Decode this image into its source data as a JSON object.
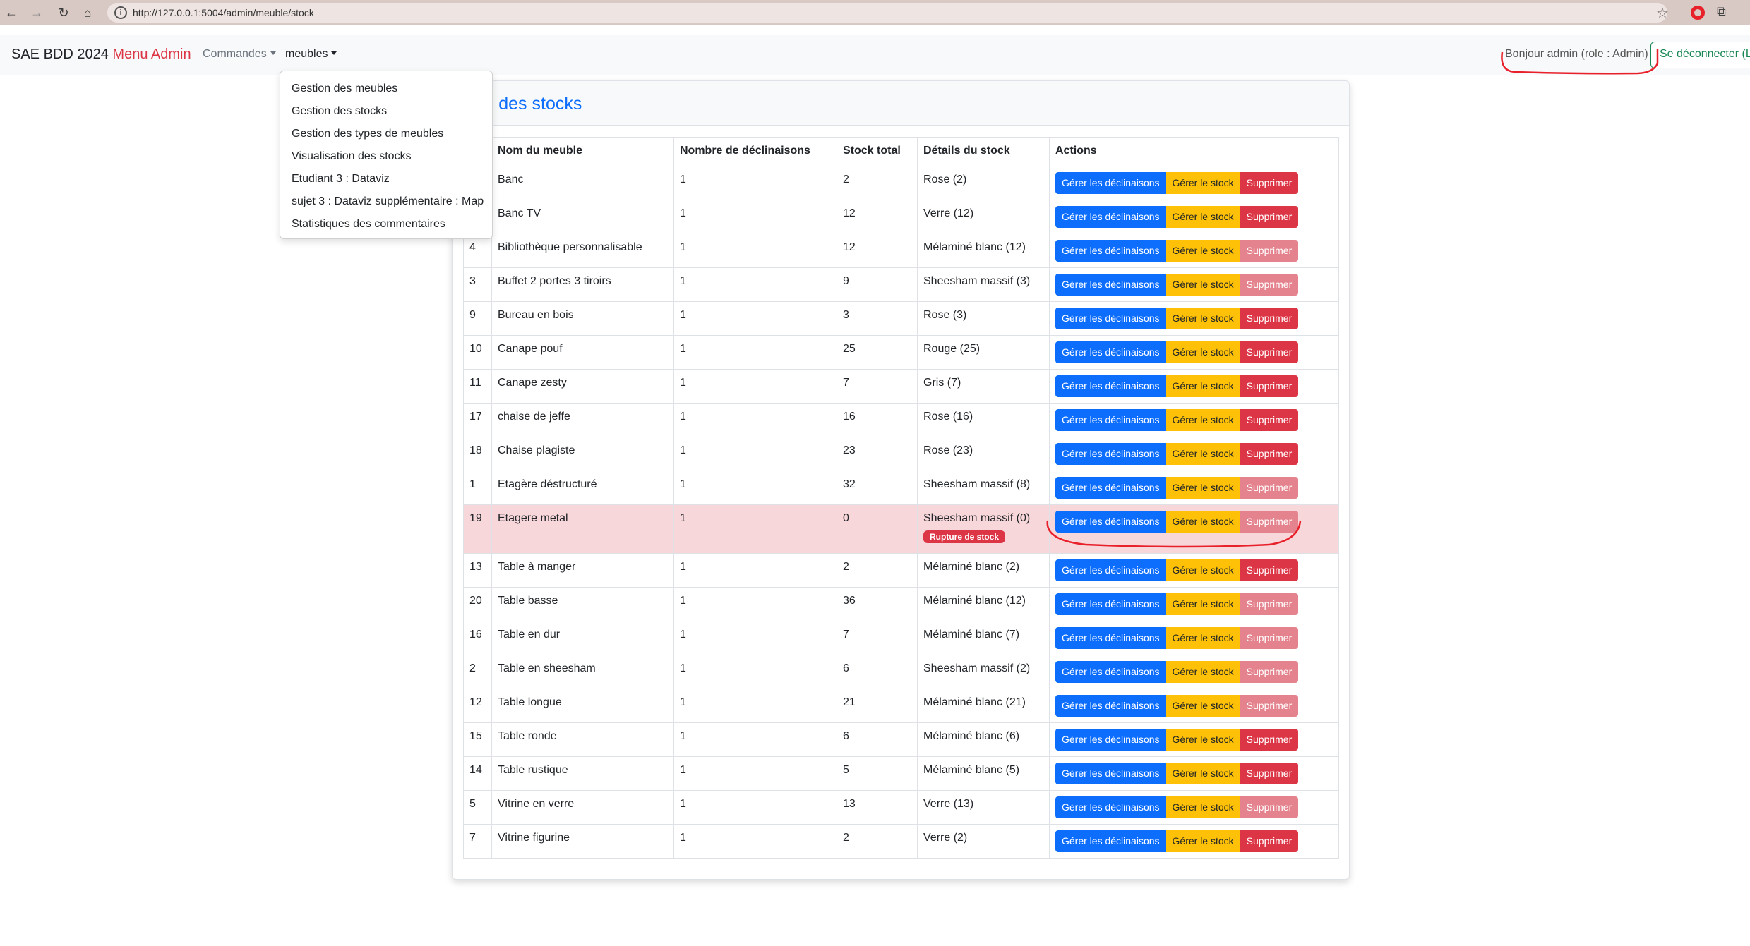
{
  "browser": {
    "url": "http://127.0.0.1:5004/admin/meuble/stock"
  },
  "navbar": {
    "brand": "SAE BDD 2024",
    "brand_accent": "Menu Admin",
    "menu_commandes": "Commandes",
    "menu_meubles": "meubles",
    "greeting": "Bonjour admin (role : Admin)",
    "logout_label": "Se déconnecter (Lo"
  },
  "dropdown": {
    "items": [
      "Gestion des meubles",
      "Gestion des stocks",
      "Gestion des types de meubles",
      "Visualisation des stocks",
      "Etudiant 3 : Dataviz",
      "sujet 3 : Dataviz supplémentaire : Map",
      "Statistiques des commentaires"
    ]
  },
  "card": {
    "title": "tion des stocks"
  },
  "table": {
    "headers": [
      "",
      "Nom du meuble",
      "Nombre de déclinaisons",
      "Stock total",
      "Détails du stock",
      "Actions"
    ],
    "action_labels": {
      "manage_variants": "Gérer les déclinaisons",
      "manage_stock": "Gérer le stock",
      "delete": "Supprimer"
    },
    "out_of_stock_badge": "Rupture de stock",
    "rows": [
      {
        "id": "",
        "name": "Banc",
        "variants": "1",
        "total": "2",
        "details": "Rose (2)",
        "delete_enabled": true
      },
      {
        "id": "",
        "name": "Banc TV",
        "variants": "1",
        "total": "12",
        "details": "Verre (12)",
        "delete_enabled": true
      },
      {
        "id": "4",
        "name": "Bibliothèque personnalisable",
        "variants": "1",
        "total": "12",
        "details": "Mélaminé blanc (12)",
        "delete_enabled": false
      },
      {
        "id": "3",
        "name": "Buffet 2 portes 3 tiroirs",
        "variants": "1",
        "total": "9",
        "details": "Sheesham massif (3)",
        "delete_enabled": false
      },
      {
        "id": "9",
        "name": "Bureau en bois",
        "variants": "1",
        "total": "3",
        "details": "Rose (3)",
        "delete_enabled": true
      },
      {
        "id": "10",
        "name": "Canape pouf",
        "variants": "1",
        "total": "25",
        "details": "Rouge (25)",
        "delete_enabled": true
      },
      {
        "id": "11",
        "name": "Canape zesty",
        "variants": "1",
        "total": "7",
        "details": "Gris (7)",
        "delete_enabled": true
      },
      {
        "id": "17",
        "name": "chaise de jeffe",
        "variants": "1",
        "total": "16",
        "details": "Rose (16)",
        "delete_enabled": true
      },
      {
        "id": "18",
        "name": "Chaise plagiste",
        "variants": "1",
        "total": "23",
        "details": "Rose (23)",
        "delete_enabled": true
      },
      {
        "id": "1",
        "name": "Etagère déstructuré",
        "variants": "1",
        "total": "32",
        "details": "Sheesham massif (8)",
        "delete_enabled": false
      },
      {
        "id": "19",
        "name": "Etagere metal",
        "variants": "1",
        "total": "0",
        "details": "Sheesham massif (0)",
        "delete_enabled": false,
        "out_of_stock": true
      },
      {
        "id": "13",
        "name": "Table à manger",
        "variants": "1",
        "total": "2",
        "details": "Mélaminé blanc (2)",
        "delete_enabled": true
      },
      {
        "id": "20",
        "name": "Table basse",
        "variants": "1",
        "total": "36",
        "details": "Mélaminé blanc (12)",
        "delete_enabled": false
      },
      {
        "id": "16",
        "name": "Table en dur",
        "variants": "1",
        "total": "7",
        "details": "Mélaminé blanc (7)",
        "delete_enabled": false
      },
      {
        "id": "2",
        "name": "Table en sheesham",
        "variants": "1",
        "total": "6",
        "details": "Sheesham massif (2)",
        "delete_enabled": false
      },
      {
        "id": "12",
        "name": "Table longue",
        "variants": "1",
        "total": "21",
        "details": "Mélaminé blanc (21)",
        "delete_enabled": false
      },
      {
        "id": "15",
        "name": "Table ronde",
        "variants": "1",
        "total": "6",
        "details": "Mélaminé blanc (6)",
        "delete_enabled": true
      },
      {
        "id": "14",
        "name": "Table rustique",
        "variants": "1",
        "total": "5",
        "details": "Mélaminé blanc (5)",
        "delete_enabled": true
      },
      {
        "id": "5",
        "name": "Vitrine en verre",
        "variants": "1",
        "total": "13",
        "details": "Verre (13)",
        "delete_enabled": false
      },
      {
        "id": "7",
        "name": "Vitrine figurine",
        "variants": "1",
        "total": "2",
        "details": "Verre (2)",
        "delete_enabled": true
      }
    ]
  },
  "colors": {
    "primary": "#0d6efd",
    "warning": "#ffc107",
    "danger": "#dc3545",
    "danger_disabled": "#e4838d",
    "row_warning_bg": "#f8d7da",
    "annotation": "#e8202a"
  }
}
